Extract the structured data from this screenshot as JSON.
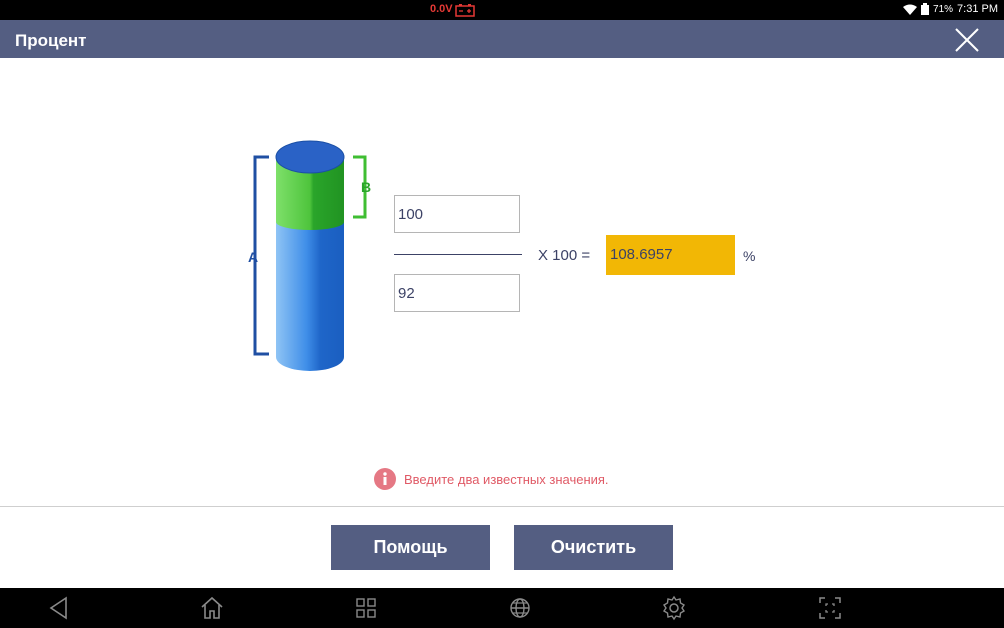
{
  "status_bar": {
    "voltage": "0.0V",
    "battery_percent": "71%",
    "time": "7:31 PM"
  },
  "header": {
    "title": "Процент"
  },
  "diagram": {
    "label_a": "A",
    "label_b": "B"
  },
  "calculator": {
    "numerator_value": "100",
    "denominator_value": "92",
    "multiplier_text": "X 100 =",
    "result_value": "108.6957",
    "unit": "%"
  },
  "hint": {
    "text": "Введите два известных значения."
  },
  "buttons": {
    "help_label": "Помощь",
    "clear_label": "Очистить"
  },
  "colors": {
    "accent": "#545e82",
    "result_bg": "#f2b705",
    "hint": "#e05a66"
  }
}
